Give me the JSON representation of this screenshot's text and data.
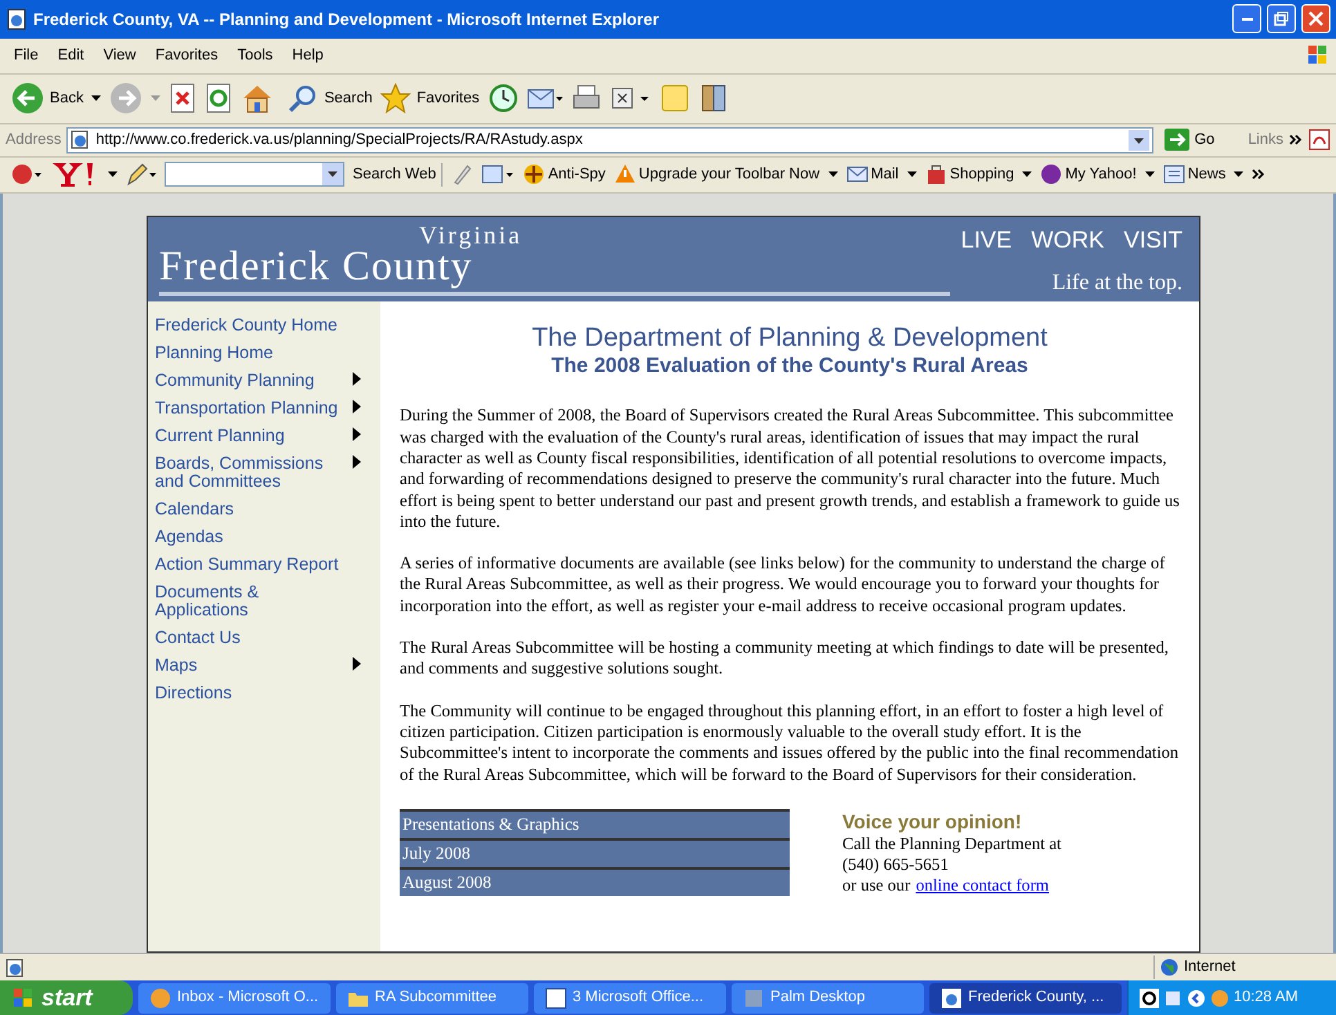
{
  "window": {
    "title": "Frederick County, VA -- Planning and Development - Microsoft Internet Explorer"
  },
  "menu": [
    "File",
    "Edit",
    "View",
    "Favorites",
    "Tools",
    "Help"
  ],
  "toolbar": {
    "back": "Back",
    "search": "Search",
    "favorites": "Favorites"
  },
  "address_bar": {
    "label": "Address",
    "url": "http://www.co.frederick.va.us/planning/SpecialProjects/RA/RAstudy.aspx",
    "go": "Go",
    "links": "Links"
  },
  "yahoo_toolbar": {
    "search": "Search Web",
    "items": [
      "Anti-Spy",
      "Upgrade your Toolbar Now",
      "Mail",
      "Shopping",
      "My Yahoo!",
      "News"
    ]
  },
  "header": {
    "state": "Virginia",
    "name": "Frederick County",
    "nav": [
      "LIVE",
      "WORK",
      "VISIT"
    ],
    "tagline": "Life at the top."
  },
  "sidebar": {
    "items": [
      {
        "label": "Frederick County Home",
        "submenu": false
      },
      {
        "label": "Planning Home",
        "submenu": false
      },
      {
        "label": "Community Planning",
        "submenu": true
      },
      {
        "label": "Transportation Planning",
        "submenu": true
      },
      {
        "label": "Current Planning",
        "submenu": true
      },
      {
        "label": "Boards, Commissions and Committees",
        "submenu": true
      },
      {
        "label": "Calendars",
        "submenu": false
      },
      {
        "label": "Agendas",
        "submenu": false
      },
      {
        "label": "Action Summary Report",
        "submenu": false
      },
      {
        "label": "Documents & Applications",
        "submenu": false
      },
      {
        "label": "Contact Us",
        "submenu": false
      },
      {
        "label": "Maps",
        "submenu": true
      },
      {
        "label": "Directions",
        "submenu": false
      }
    ]
  },
  "content": {
    "heading": "The Department of Planning & Development",
    "subheading": "The 2008 Evaluation of the County's Rural Areas",
    "paragraphs": [
      "During the Summer of 2008, the Board of Supervisors created the Rural Areas Subcommittee. This subcommittee was charged with the evaluation of the County's rural areas, identification of issues that may impact the rural character as well as County fiscal responsibilities, identification of all potential resolutions to overcome impacts, and forwarding of recommendations designed to preserve the community's rural character into the future. Much effort is being spent to better understand our past and present growth trends, and establish a framework to guide us into the future.",
      "A series of informative documents are available (see links below) for the community to understand the charge of the Rural Areas Subcommittee, as well as their progress. We would encourage you to forward your thoughts for incorporation into the effort, as well as register your e-mail address to receive occasional program updates.",
      "The Rural Areas Subcommittee will be hosting a community meeting at which findings to date will be presented, and comments and suggestive solutions sought.",
      "The Community will continue to be engaged throughout this planning effort, in an effort to foster a high level of citizen participation. Citizen participation is enormously valuable to the overall study effort. It is the Subcommittee's intent to incorporate the comments and issues offered by the public into the final recommendation of the Rural Areas Subcommittee, which will be forward to the Board of Supervisors for their consideration."
    ],
    "documents": [
      "Presentations & Graphics",
      "July 2008",
      "August 2008"
    ],
    "voice": {
      "title": "Voice your opinion!",
      "lines": [
        "Call the Planning Department at",
        "(540) 665-5651"
      ],
      "prefix": "or use our",
      "link": "online contact form"
    }
  },
  "status_bar": {
    "zone": "Internet"
  },
  "taskbar": {
    "start": "start",
    "tasks": [
      {
        "label": "Inbox - Microsoft O...",
        "selected": false
      },
      {
        "label": "RA Subcommittee",
        "selected": false
      },
      {
        "label": "3 Microsoft Office...",
        "selected": false
      },
      {
        "label": "Palm Desktop",
        "selected": false
      },
      {
        "label": "Frederick County, ...",
        "selected": true
      }
    ],
    "clock": "10:28 AM"
  }
}
